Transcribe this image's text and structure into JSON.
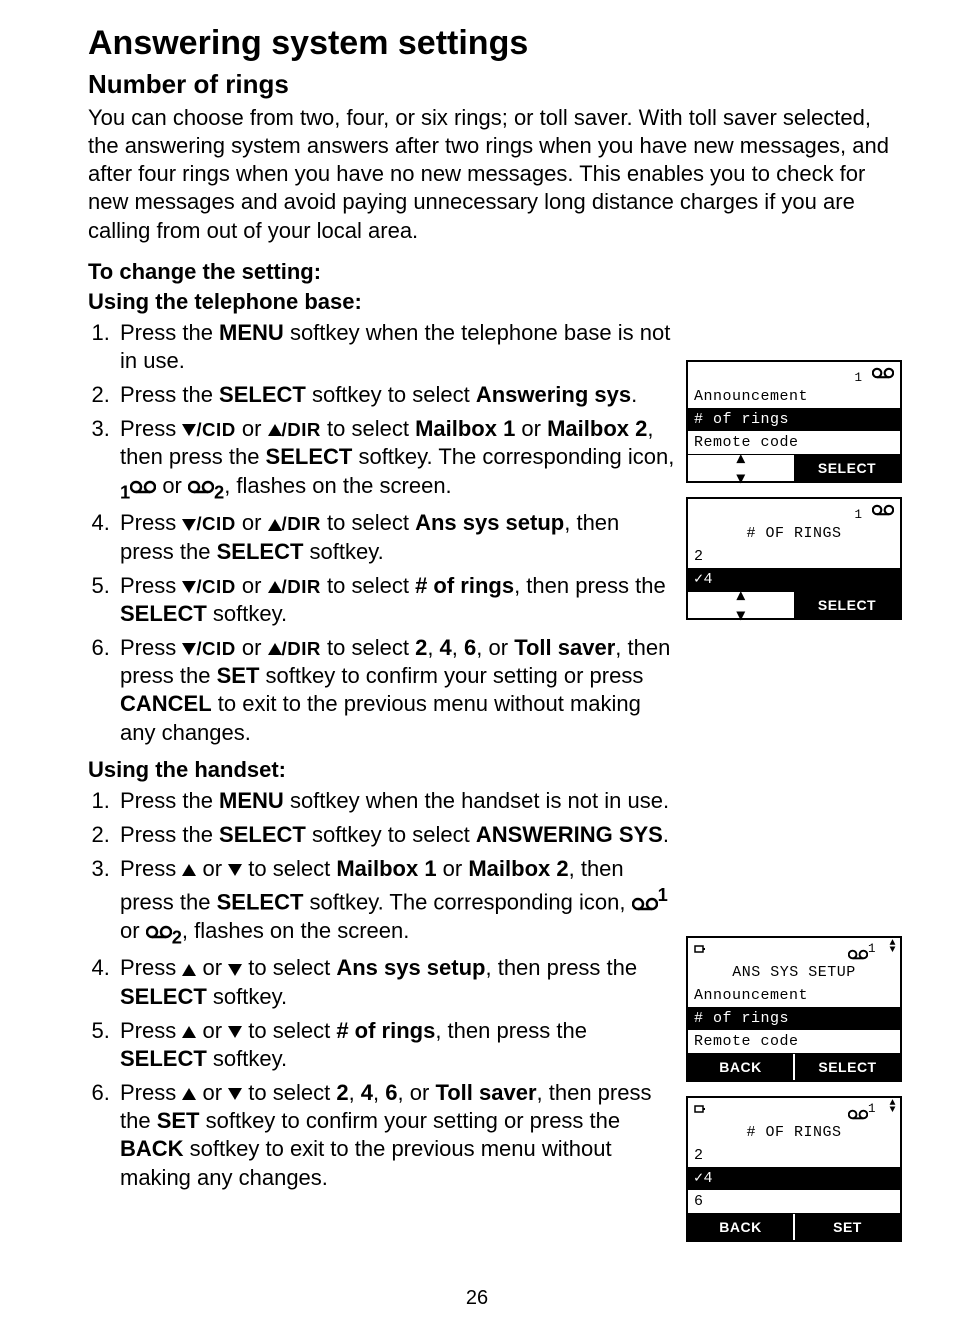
{
  "page_number": "26",
  "h1": "Answering system settings",
  "h2": "Number of rings",
  "intro": "You can choose from two, four, or six rings; or toll saver. With toll saver selected, the answering system answers after two rings when you have new messages, and after four rings when you have no new messages. This enables you to check for new messages and avoid paying unnecessary long distance charges if you are calling from out of your local area.",
  "h3": "To change the setting:",
  "base_heading": "Using the telephone base:",
  "base_steps": {
    "s1_a": "Press the ",
    "s1_menu": "MENU",
    "s1_b": " softkey when the telephone base is not in use.",
    "s2_a": "Press the ",
    "s2_select": "SELECT",
    "s2_b": " softkey to select ",
    "s2_c": "Answering sys",
    "s2_d": ".",
    "s3_a": "Press ",
    "s3_cid": "/CID",
    "s3_b": " or ",
    "s3_dir": "/DIR",
    "s3_c": " to select ",
    "s3_m1": "Mailbox 1",
    "s3_d": " or ",
    "s3_m2": "Mailbox 2",
    "s3_e": ", then press the ",
    "s3_sel": "SELECT",
    "s3_f": " softkey. The corresponding icon, ",
    "s3_sub1": "1",
    "s3_g": " or ",
    "s3_sub2": "2",
    "s3_h": ", flashes on the screen.",
    "s4_a": "Press ",
    "s4_b": " or ",
    "s4_c": " to select ",
    "s4_d": "Ans sys setup",
    "s4_e": ", then press the ",
    "s4_f": "SELECT",
    "s4_g": " softkey.",
    "s5_a": "Press ",
    "s5_b": " or ",
    "s5_c": " to select ",
    "s5_d": "# of rings",
    "s5_e": ", then press the ",
    "s5_f": "SELECT",
    "s5_g": " softkey.",
    "s6_a": "Press ",
    "s6_b": " or ",
    "s6_c": " to select ",
    "s6_2": "2",
    "s6_d": ", ",
    "s6_4": "4",
    "s6_e": ", ",
    "s6_6": "6",
    "s6_f": ", or ",
    "s6_ts": "Toll saver",
    "s6_g": ", then press the ",
    "s6_set": "SET",
    "s6_h": " softkey to confirm your setting or press ",
    "s6_cancel": "CANCEL",
    "s6_i": " to exit to the previous menu without making any changes."
  },
  "handset_heading": "Using the handset:",
  "hand_steps": {
    "s1_a": "Press the ",
    "s1_menu": "MENU",
    "s1_b": " softkey when the handset is not in use.",
    "s2_a": "Press the ",
    "s2_select": "SELECT",
    "s2_b": " softkey to select ",
    "s2_c": "ANSWERING SYS",
    "s2_d": ".",
    "s3_a": "Press ",
    "s3_b": " or ",
    "s3_c": " to select ",
    "s3_m1": "Mailbox 1",
    "s3_d": " or ",
    "s3_m2": "Mailbox 2",
    "s3_e": ", then press the ",
    "s3_sel": "SELECT",
    "s3_f": " softkey. The corresponding icon, ",
    "s3_sup1": "1",
    "s3_g": " or ",
    "s3_sub2": "2",
    "s3_h": ", flashes on the screen.",
    "s4_a": "Press ",
    "s4_b": " or ",
    "s4_c": " to select ",
    "s4_d": "Ans sys setup",
    "s4_e": ", then press the ",
    "s4_f": "SELECT",
    "s4_g": " softkey.",
    "s5_a": "Press ",
    "s5_b": " or ",
    "s5_c": " to select ",
    "s5_d": "# of rings",
    "s5_e": ", then press the ",
    "s5_f": "SELECT",
    "s5_g": " softkey.",
    "s6_a": "Press ",
    "s6_b": " or ",
    "s6_c": " to select ",
    "s6_2": "2",
    "s6_d": ", ",
    "s6_4": "4",
    "s6_e": ", ",
    "s6_6": "6",
    "s6_f": ", or ",
    "s6_ts": "Toll saver",
    "s6_g": ", then press the ",
    "s6_set": "SET",
    "s6_h": " softkey to confirm your setting or press the ",
    "s6_back": "BACK",
    "s6_i": " softkey to exit to the previous menu without making any changes."
  },
  "lcd_base_1": {
    "top_icon_sub": "1",
    "line1": "Announcement",
    "sel": "# of rings",
    "line3": "Remote code",
    "soft_right": "SELECT"
  },
  "lcd_base_2": {
    "top_icon_sub": "1",
    "title": "# OF RINGS",
    "line1": " 2",
    "sel": "✓4",
    "soft_right": "SELECT"
  },
  "lcd_hand_1": {
    "sup": "1",
    "title": "ANS SYS SETUP",
    "line1": "Announcement",
    "sel": "# of rings",
    "line3": "Remote code",
    "left": "BACK",
    "right": "SELECT"
  },
  "lcd_hand_2": {
    "sup": "1",
    "title": "# OF RINGS",
    "line1": " 2",
    "sel": "✓4",
    "line3": " 6",
    "left": "BACK",
    "right": "SET"
  }
}
